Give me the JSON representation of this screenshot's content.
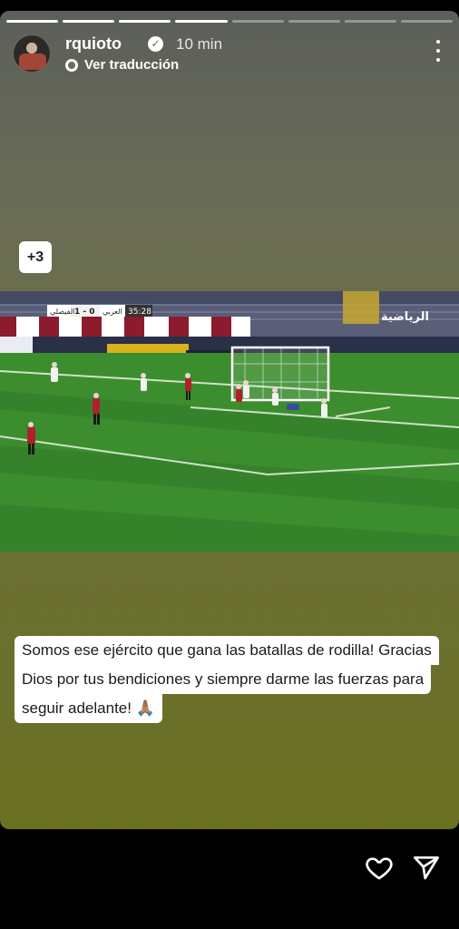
{
  "story": {
    "segment_count": 8,
    "active_progress": [
      1,
      1,
      1,
      1,
      0,
      0,
      0,
      0
    ],
    "header": {
      "username": "rquioto",
      "time": "10 min",
      "translate_label": "Ver traducción"
    },
    "extra_count_badge": "+3",
    "video": {
      "scoreboard": {
        "team_left": "الفيصلي",
        "score": "1 - 0",
        "team_right": "العربي",
        "clock": "35:28"
      },
      "channel_logo": "الرياضية",
      "colors": {
        "pitch_dark": "#2f7a25",
        "pitch_light": "#3c8d2e",
        "red_team": "#b0202a",
        "white_team": "#f2f2f2"
      }
    },
    "caption": {
      "line1": "Somos ese ejército que gana las batallas de rodilla! Gracias",
      "line2": "Dios por tus bendiciones y siempre darme las fuerzas para",
      "line3": "seguir adelante! 🙏🏽"
    }
  },
  "icons": {
    "verified": "verified-badge-icon",
    "translate": "globe-icon",
    "more": "more-options-icon",
    "like": "heart-icon",
    "share": "send-icon"
  }
}
